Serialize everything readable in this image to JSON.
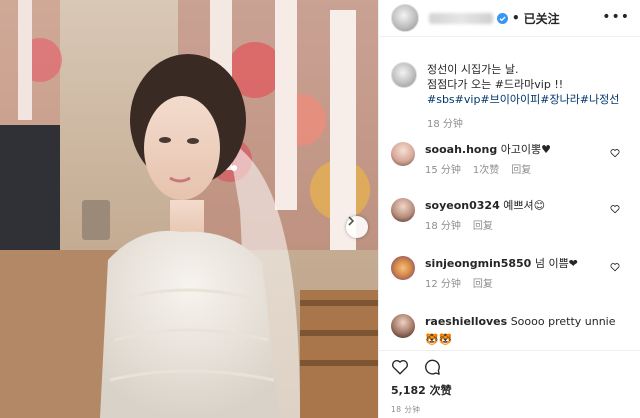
{
  "header": {
    "follow_status": "已关注",
    "more_icon": "more-horizontal-icon"
  },
  "caption": {
    "line1": "정선이 시집가는 날.",
    "line2": "점점다가 오는 #드라마vip !!",
    "line3": "#sbs#vip#브이아이피#장나라#나정선",
    "time": "18 分钟"
  },
  "comments": [
    {
      "user": "sooah.hong",
      "text": "아고이뽕♥",
      "time": "15 分钟",
      "likes": "1次赞",
      "reply": "回复"
    },
    {
      "user": "soyeon0324",
      "text": "예쁘셔😊",
      "time": "18 分钟",
      "reply": "回复"
    },
    {
      "user": "sinjeongmin5850",
      "text": "넘 이쁨❤",
      "time": "12 分钟",
      "reply": "回复"
    },
    {
      "user": "raeshielloves",
      "text": "Soooo pretty unnie",
      "emoji": "🐯🐯"
    }
  ],
  "post": {
    "likes": "5,182 次赞",
    "posted_ago": "18 分钟"
  },
  "colors": {
    "link": "#00376b",
    "verified": "#3897f0",
    "muted": "#8e8e8e"
  }
}
